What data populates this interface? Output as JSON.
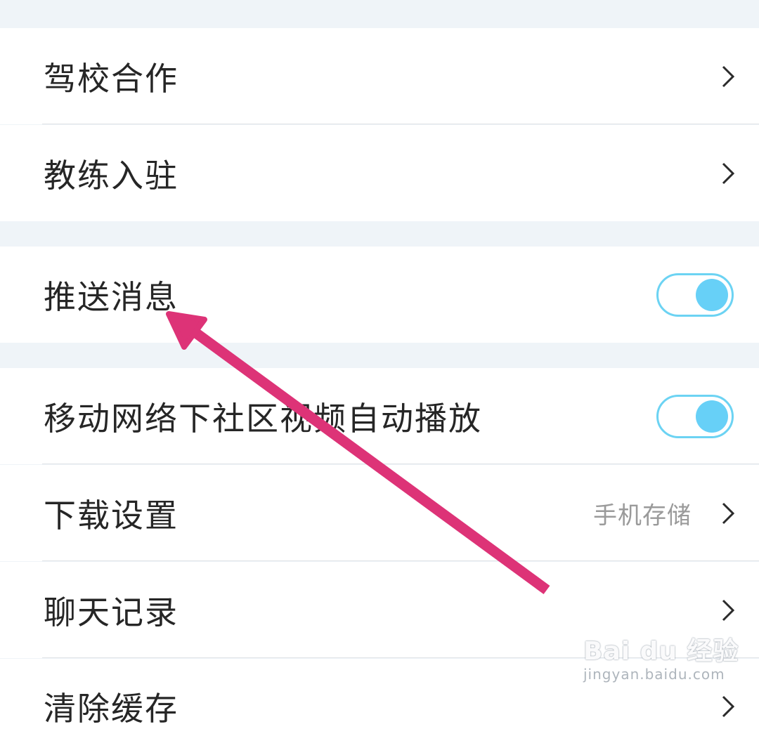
{
  "settings": {
    "driving_school": {
      "label": "驾校合作"
    },
    "coach_join": {
      "label": "教练入驻"
    },
    "push_messages": {
      "label": "推送消息",
      "enabled": true
    },
    "autoplay_video": {
      "label": "移动网络下社区视频自动播放",
      "enabled": true
    },
    "download_settings": {
      "label": "下载设置",
      "value": "手机存储"
    },
    "chat_history": {
      "label": "聊天记录"
    },
    "clear_cache": {
      "label": "清除缓存"
    }
  },
  "annotation": {
    "arrow_color": "#dd3377"
  },
  "watermark": {
    "logo": "Bai du 经验",
    "url": "jingyan.baidu.com"
  },
  "colors": {
    "toggle_accent": "#67d0f7",
    "background": "#eff4f8"
  }
}
